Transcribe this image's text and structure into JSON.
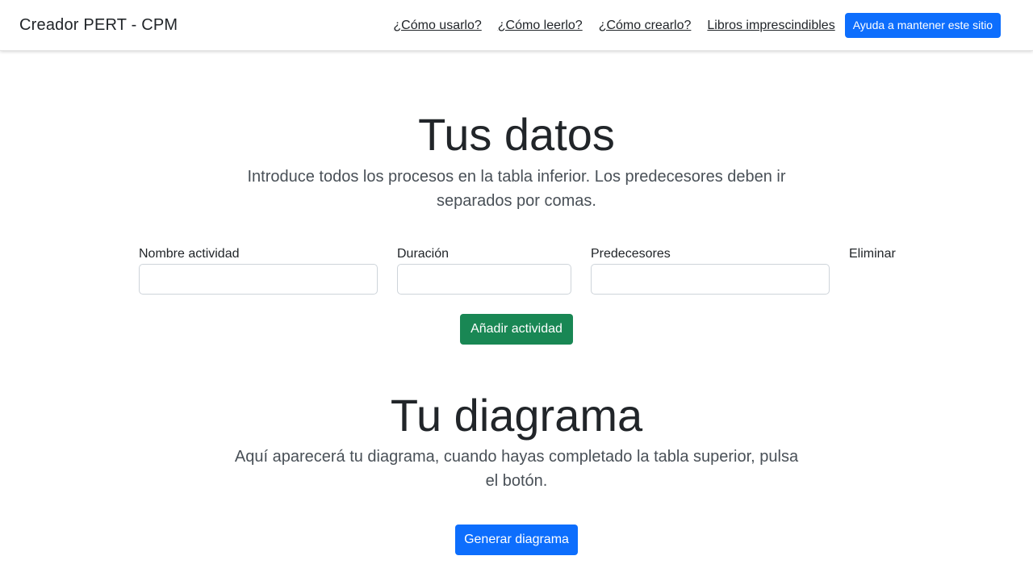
{
  "navbar": {
    "brand": "Creador PERT - CPM",
    "links": [
      {
        "label": "¿Cómo usarlo?"
      },
      {
        "label": "¿Cómo leerlo?"
      },
      {
        "label": "¿Cómo crearlo?"
      },
      {
        "label": "Libros imprescindibles"
      }
    ],
    "support_button": "Ayuda a mantener este sitio"
  },
  "data_section": {
    "title": "Tus datos",
    "lead_line1": "Introduce todos los procesos en la tabla inferior. Los predecesores deben ir",
    "lead_line2": "separados por comas.",
    "columns": {
      "name": "Nombre actividad",
      "duration": "Duración",
      "predecessors": "Predecesores",
      "delete": "Eliminar"
    },
    "inputs": {
      "name_value": "",
      "duration_value": "",
      "predecessors_value": ""
    },
    "add_button": "Añadir actividad"
  },
  "diagram_section": {
    "title": "Tu diagrama",
    "lead_line1": "Aquí aparecerá tu diagrama, cuando hayas completado la tabla superior, pulsa",
    "lead_line2": "el botón.",
    "generate_button": "Generar diagrama"
  },
  "colors": {
    "primary": "#0d6efd",
    "success": "#198754"
  }
}
